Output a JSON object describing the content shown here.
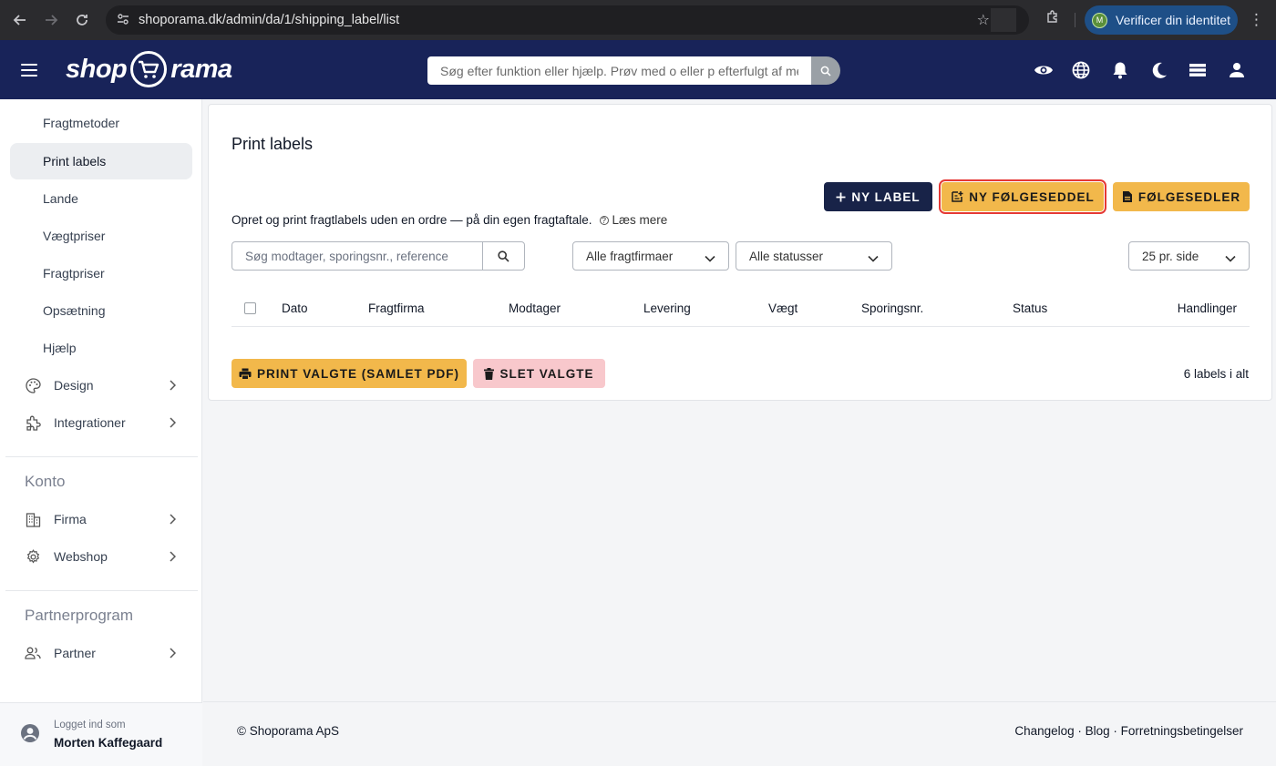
{
  "browser": {
    "url": "shoporama.dk/admin/da/1/shipping_label/list",
    "verify_label": "Verificer din identitet",
    "verify_avatar": "M"
  },
  "header": {
    "logo_left": "shop",
    "logo_right": "rama",
    "search_placeholder": "Søg efter funktion eller hjælp. Prøv med o eller p efterfulgt af mellemrum",
    "icons": [
      "eye-icon",
      "globe-icon",
      "bell-icon",
      "moon-icon",
      "card-icon",
      "person-icon"
    ]
  },
  "sidebar": {
    "items": [
      {
        "label": "Fragtmetoder"
      },
      {
        "label": "Print labels",
        "active": true
      },
      {
        "label": "Lande"
      },
      {
        "label": "Vægtpriser"
      },
      {
        "label": "Fragtpriser"
      },
      {
        "label": "Opsætning"
      },
      {
        "label": "Hjælp"
      }
    ],
    "groups": {
      "design": "Design",
      "integrationer": "Integrationer",
      "firma": "Firma",
      "webshop": "Webshop",
      "partner": "Partner"
    },
    "sections": {
      "konto": "Konto",
      "partnerprogram": "Partnerprogram"
    },
    "user": {
      "label": "Logget ind som",
      "name": "Morten Kaffegaard"
    }
  },
  "main": {
    "title": "Print labels",
    "buttons": {
      "new_label": "NY LABEL",
      "new_slip": "NY FØLGESEDDEL",
      "slips": "FØLGESEDLER",
      "print_selected": "PRINT VALGTE (SAMLET PDF)",
      "delete_selected": "SLET VALGTE"
    },
    "description": "Opret og print fragtlabels uden en ordre — på din egen fragtaftale.",
    "read_more": "Læs mere",
    "filters": {
      "search_placeholder": "Søg modtager, sporingsnr., reference",
      "carrier": "Alle fragtfirmaer",
      "status": "Alle statusser",
      "per_page": "25 pr. side"
    },
    "columns": [
      "Dato",
      "Fragtfirma",
      "Modtager",
      "Levering",
      "Vægt",
      "Sporingsnr.",
      "Status",
      "Handlinger"
    ],
    "count": "6 labels i alt"
  },
  "footer": {
    "copyright": "© Shoporama ApS",
    "links": "Changelog · Blog · Forretningsbetingelser"
  },
  "colors": {
    "header_bg": "#182359",
    "primary_navy": "#182348",
    "accent_yellow": "#f2b84b",
    "danger_pink": "#f8c8cc",
    "highlight_red": "#e53935"
  }
}
